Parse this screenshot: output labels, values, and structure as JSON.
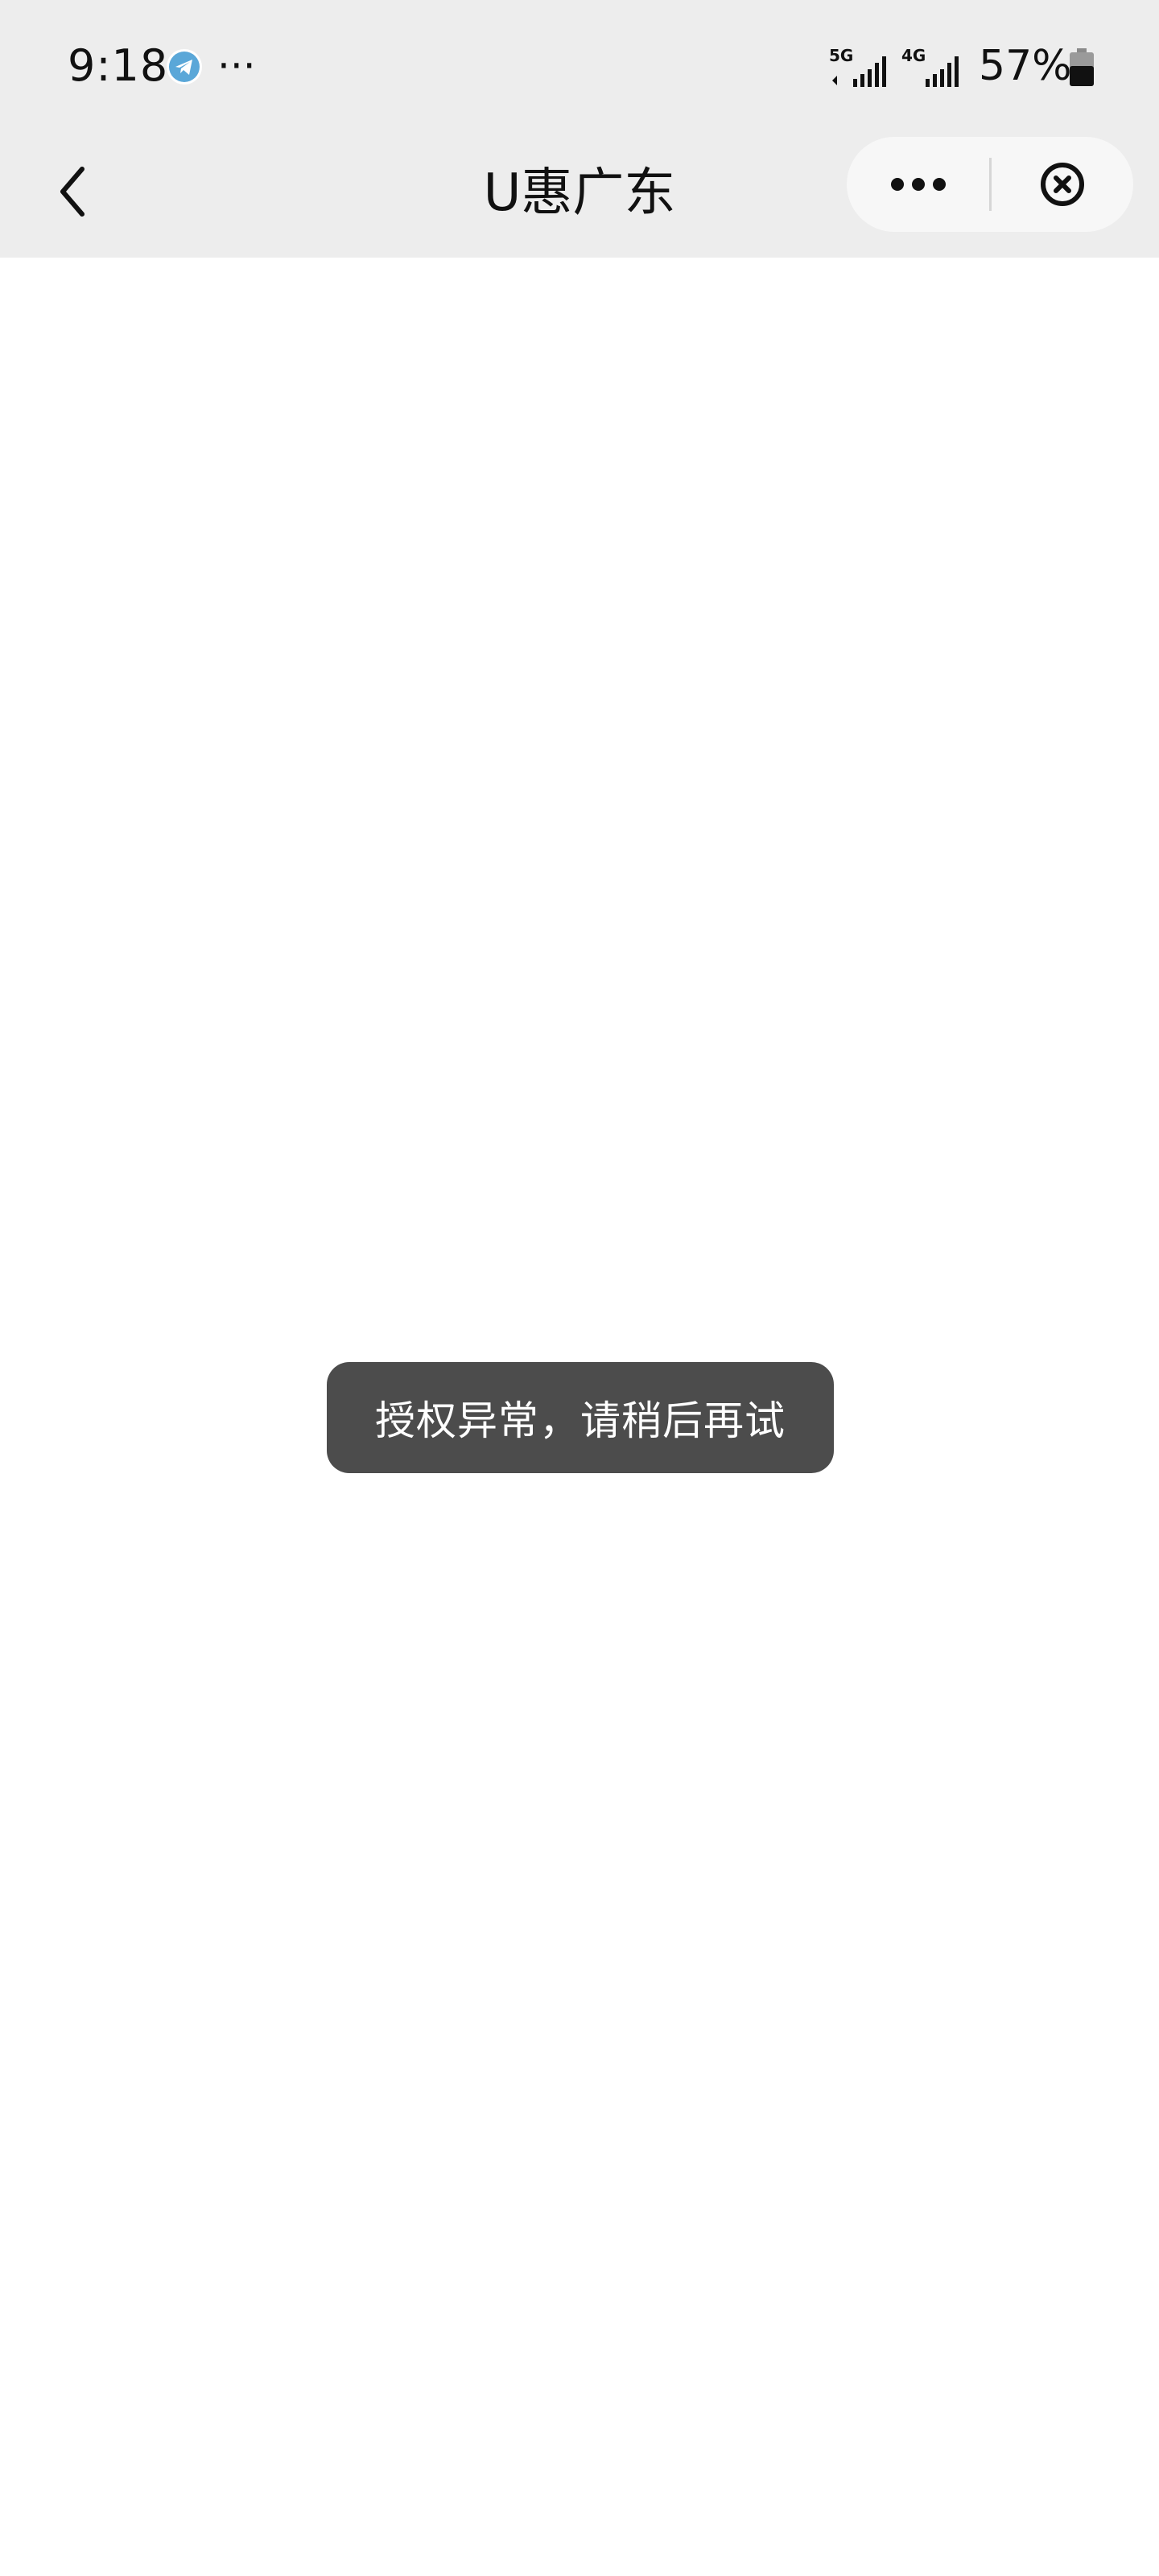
{
  "status_bar": {
    "time": "9:18",
    "more_indicator": "···",
    "network_1": "5G",
    "network_2": "4G",
    "battery": "57%"
  },
  "nav": {
    "title": "U惠广东"
  },
  "toast": {
    "message": "授权异常，请稍后再试"
  },
  "icons": {
    "back": "chevron-left-icon",
    "more": "more-dots-icon",
    "close": "close-circle-icon",
    "telegram": "telegram-icon"
  },
  "colors": {
    "header_bg": "#ededed",
    "toast_bg": "#4c4c4c",
    "telegram_blue": "#5aa7d8"
  }
}
